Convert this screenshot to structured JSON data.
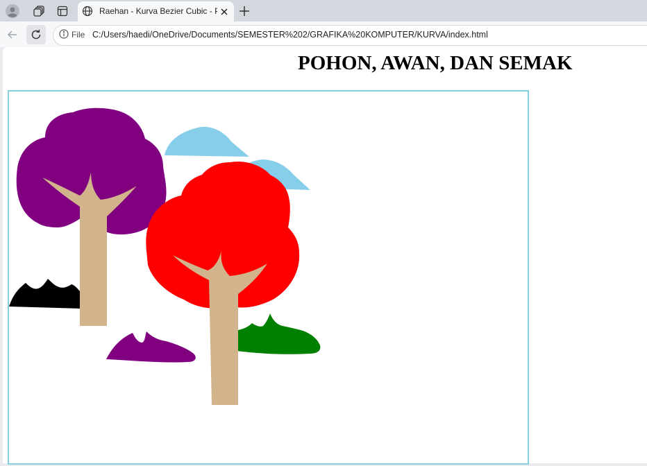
{
  "browser": {
    "tab_title": "Raehan - Kurva Bezier Cubic - Pohon, Awan, dan Semak",
    "address_chip_label": "File",
    "url": "C:/Users/haedi/OneDrive/Documents/SEMESTER%202/GRAFIKA%20KOMPUTER/KURVA/index.html",
    "icons": {
      "profile": "profile-icon",
      "workspaces": "workspaces-icon",
      "tab_actions": "tab-actions-icon",
      "globe": "globe-icon",
      "close": "close-icon",
      "new_tab": "plus-icon",
      "back": "back-arrow-icon",
      "reload": "reload-icon",
      "info": "info-icon"
    }
  },
  "page": {
    "heading": "POHON, AWAN, DAN SEMAK"
  },
  "scene": {
    "colors": {
      "canvas_border": "#87cedf",
      "tree_purple": "#800080",
      "tree_red": "#ff0000",
      "trunk": "#d2b48c",
      "cloud": "#87ceeb",
      "bush_black": "#000000",
      "bush_purple": "#800080",
      "bush_green": "#008000"
    }
  }
}
